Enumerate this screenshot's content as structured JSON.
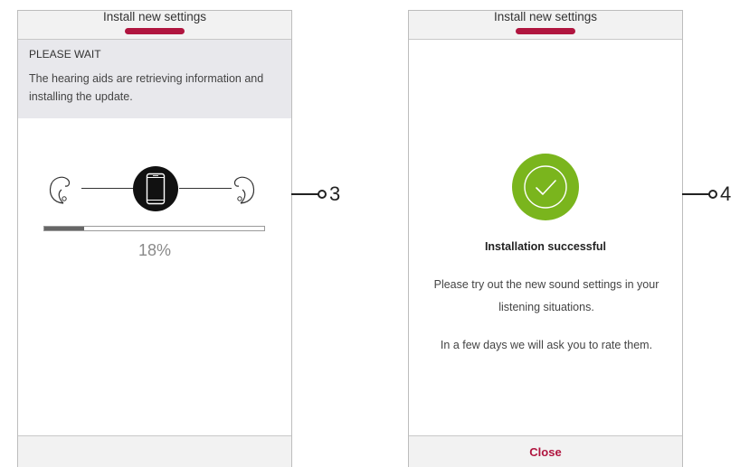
{
  "screen_left": {
    "header": {
      "title": "Install new settings"
    },
    "wait_panel": {
      "title": "PLEASE WAIT",
      "text": "The hearing aids are retrieving information and installing the update."
    },
    "progress": {
      "value": 0.18,
      "label": "18%"
    },
    "icons": [
      "hearing-aid-left-icon",
      "smartphone-icon",
      "hearing-aid-right-icon"
    ]
  },
  "screen_right": {
    "header": {
      "title": "Install new settings"
    },
    "success": {
      "icon": "checkmark-circle-icon",
      "title": "Installation successful",
      "message": "Please try out the new sound settings in your listening situations.",
      "message2": "In a few days we will ask you to rate them."
    },
    "footer": {
      "close_label": "Close"
    }
  },
  "callouts": {
    "left": "3",
    "right": "4"
  },
  "colors": {
    "accent": "#b0153f",
    "success_green": "#7ab51d",
    "panel_gray": "#e8e8ec",
    "header_gray": "#f2f2f2"
  }
}
